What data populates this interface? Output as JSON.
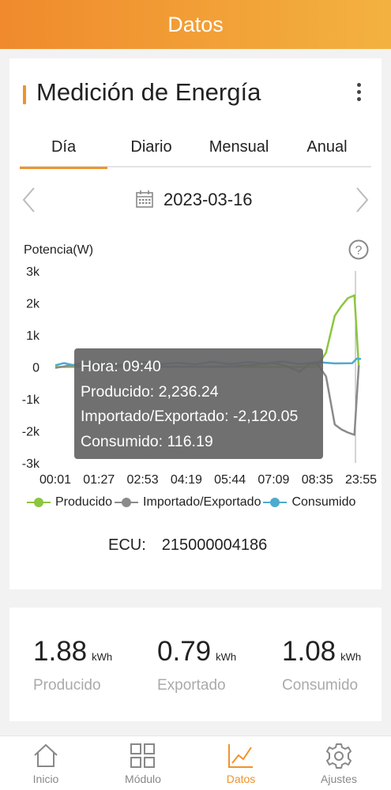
{
  "header": {
    "title": "Datos"
  },
  "card": {
    "title": "Medición de Energía",
    "menu_icon": "more-vertical-icon",
    "tabs": [
      {
        "label": "Día",
        "active": true
      },
      {
        "label": "Diario",
        "active": false
      },
      {
        "label": "Mensual",
        "active": false
      },
      {
        "label": "Anual",
        "active": false
      }
    ],
    "date": "2023-03-16",
    "help_icon": "question-circle-icon"
  },
  "chart_data": {
    "type": "line",
    "ylabel": "Potencia(W)",
    "ylim": [
      -3000,
      3000
    ],
    "yticks": [
      "3k",
      "2k",
      "1k",
      "0",
      "-1k",
      "-2k",
      "-3k"
    ],
    "xticks": [
      "00:01",
      "01:27",
      "02:53",
      "04:19",
      "05:44",
      "07:09",
      "08:35",
      "23:55"
    ],
    "grid": false,
    "legend_position": "bottom",
    "series": [
      {
        "name": "Producido",
        "color": "#8cc63f",
        "x": [
          0,
          1,
          2,
          3,
          4,
          5,
          5.2,
          5.5,
          5.8,
          6.0,
          6.2,
          6.4,
          6.55,
          6.7,
          6.85,
          6.95
        ],
        "y": [
          0,
          0,
          0,
          0,
          0,
          0,
          0,
          0,
          0,
          20,
          450,
          1600,
          1900,
          2150,
          2236.24,
          0
        ]
      },
      {
        "name": "Importado/Exportado",
        "color": "#8a8a8a",
        "x": [
          0,
          0.3,
          1,
          2,
          3,
          4,
          4.5,
          5,
          5.3,
          5.6,
          5.8,
          6.0,
          6.2,
          6.4,
          6.55,
          6.7,
          6.85,
          6.95
        ],
        "y": [
          -30,
          40,
          30,
          20,
          10,
          20,
          60,
          120,
          30,
          -150,
          90,
          100,
          -300,
          -1800,
          -1950,
          -2050,
          -2120.05,
          50
        ]
      },
      {
        "name": "Consumido",
        "color": "#4eaacf",
        "x": [
          0,
          0.2,
          0.4,
          0.6,
          0.8,
          1,
          1.3,
          1.6,
          2,
          2.4,
          2.8,
          3.2,
          3.6,
          4,
          4.4,
          4.8,
          5.2,
          5.6,
          6,
          6.4,
          6.8,
          6.9,
          7
        ],
        "y": [
          50,
          120,
          60,
          130,
          70,
          140,
          80,
          60,
          150,
          90,
          130,
          80,
          160,
          90,
          150,
          110,
          170,
          90,
          150,
          110,
          116.19,
          260,
          250
        ]
      }
    ]
  },
  "tooltip": {
    "hora": "Hora: 09:40",
    "producido": "Producido: 2,236.24",
    "importado": "Importado/Exportado: -2,120.05",
    "consumido": "Consumido: 116.19"
  },
  "ecu": {
    "label": "ECU:",
    "value": "215000004186"
  },
  "stats": [
    {
      "value": "1.88",
      "unit": "kWh",
      "label": "Producido"
    },
    {
      "value": "0.79",
      "unit": "kWh",
      "label": "Exportado"
    },
    {
      "value": "1.08",
      "unit": "kWh",
      "label": "Consumido"
    }
  ],
  "tabbar": [
    {
      "label": "Inicio",
      "icon": "home-icon",
      "active": false
    },
    {
      "label": "Módulo",
      "icon": "grid-icon",
      "active": false
    },
    {
      "label": "Datos",
      "icon": "line-chart-icon",
      "active": true
    },
    {
      "label": "Ajustes",
      "icon": "gear-icon",
      "active": false
    }
  ],
  "colors": {
    "accent": "#f0932b",
    "header_start": "#f08a2c",
    "header_end": "#f3b240"
  }
}
